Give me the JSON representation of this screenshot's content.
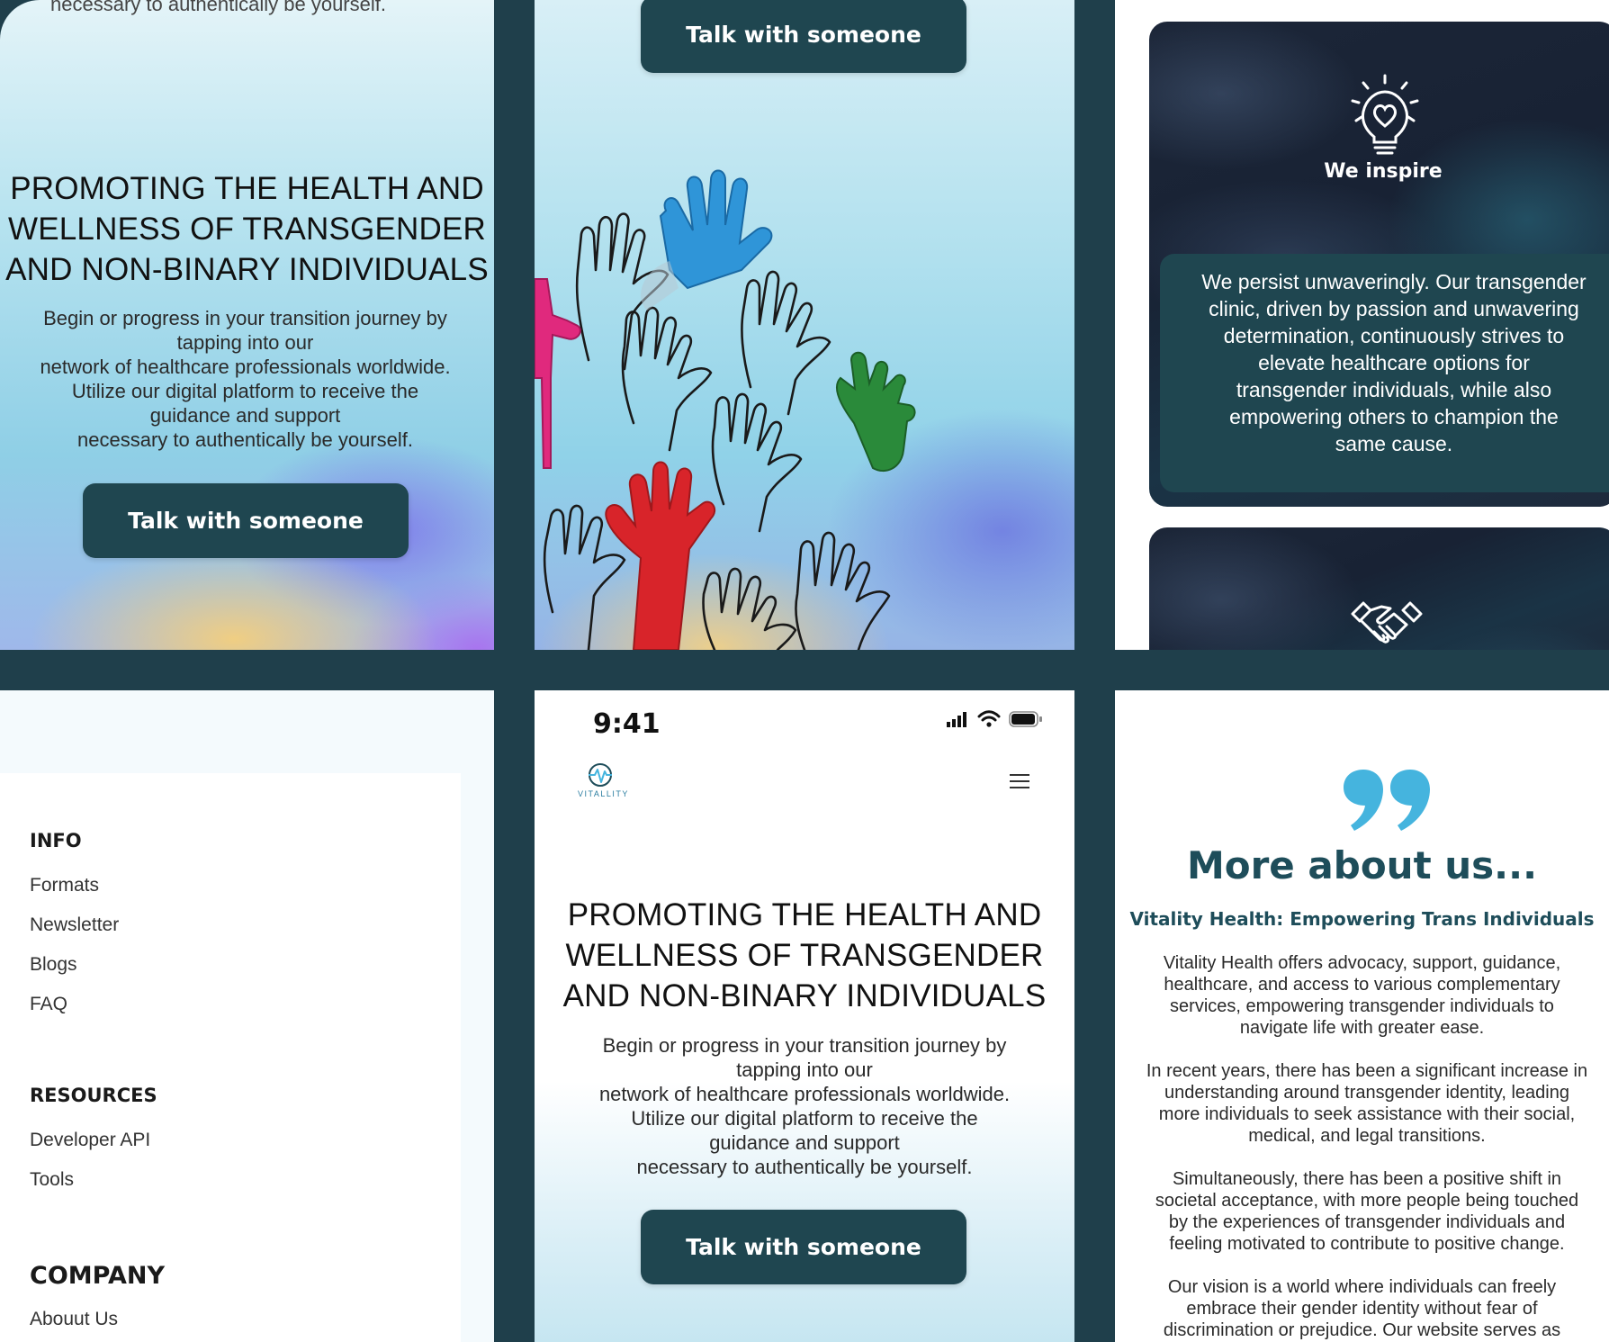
{
  "hero": {
    "title_lines": [
      "PROMOTING THE HEALTH AND",
      "WELLNESS OF TRANSGENDER",
      "AND NON-BINARY INDIVIDUALS"
    ],
    "body_lines": [
      "Begin or progress in your transition journey by",
      "tapping into our",
      "network of healthcare professionals worldwide.",
      "Utilize our digital platform to receive the",
      "guidance and support",
      "necessary to authentically be yourself."
    ],
    "top_cut_line": "necessary to authentically be yourself.",
    "cta_label": "Talk with someone"
  },
  "values": {
    "inspire_title": "We inspire",
    "inspire_icon": "lightbulb-heart-icon",
    "persist_lines": [
      "We persist unwaveringly. Our transgender",
      "clinic, driven by passion and unwavering",
      "determination, continuously strives to",
      "elevate healthcare options for",
      "transgender individuals, while also",
      "empowering others to champion the",
      "same cause."
    ],
    "second_icon": "handshake-icon"
  },
  "footer": {
    "info_heading": "INFO",
    "info_links": [
      "Formats",
      "Newsletter",
      "Blogs",
      "FAQ"
    ],
    "resources_heading": "RESOURCES",
    "resources_links": [
      "Developer API",
      "Tools"
    ],
    "company_heading": "COMPANY",
    "company_links": [
      "Abouut Us"
    ]
  },
  "mobile": {
    "time": "9:41",
    "logo_text": "VITALLITY",
    "menu_icon": "hamburger-menu-icon"
  },
  "about": {
    "heading": "More about us...",
    "subheading": "Vitality Health: Empowering Trans Individuals",
    "p1": [
      "Vitality Health offers advocacy, support, guidance,",
      "healthcare, and access to various complementary",
      "services, empowering transgender individuals to",
      "navigate life with greater ease."
    ],
    "p2": [
      "In recent years, there has been a significant increase in",
      "understanding around transgender identity, leading",
      "more individuals to seek assistance with their social,",
      "medical, and legal transitions."
    ],
    "p3": [
      "Simultaneously, there has been a positive shift in",
      "societal acceptance, with more people being touched",
      "by the experiences of transgender individuals and",
      "feeling motivated to contribute to positive change."
    ],
    "p4": [
      "Our vision is a world where individuals can freely",
      "embrace their gender identity without fear of",
      "discrimination or prejudice. Our website serves as"
    ]
  },
  "colors": {
    "dark_teal": "#1f4650",
    "frame": "#1f3f4b",
    "accent_blue": "#45b4de",
    "heading_teal": "#1e4d5a"
  }
}
